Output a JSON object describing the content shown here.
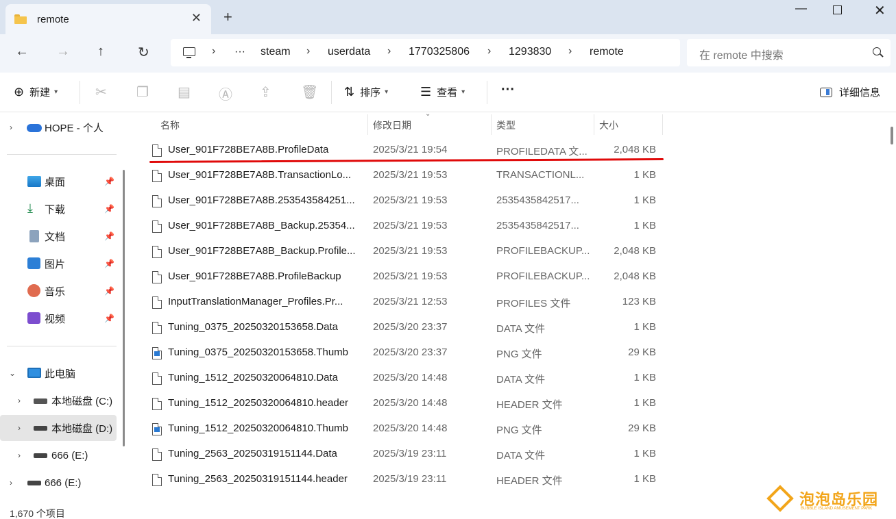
{
  "window": {
    "tab_title": "remote",
    "new_tab": "+",
    "close_tab": "✕"
  },
  "nav": {
    "breadcrumb": [
      "···",
      "steam",
      "userdata",
      "1770325806",
      "1293830",
      "remote"
    ],
    "search_placeholder": "在 remote 中搜索"
  },
  "toolbar": {
    "new_label": "新建",
    "sort_label": "排序",
    "view_label": "查看",
    "more_label": "···",
    "details_label": "详细信息"
  },
  "sidebar": {
    "onedrive": "HOPE - 个人",
    "quick": [
      {
        "label": "桌面",
        "icon": "desktop-icon"
      },
      {
        "label": "下载",
        "icon": "download-icon"
      },
      {
        "label": "文档",
        "icon": "documents-icon"
      },
      {
        "label": "图片",
        "icon": "pictures-icon"
      },
      {
        "label": "音乐",
        "icon": "music-icon"
      },
      {
        "label": "视频",
        "icon": "videos-icon"
      }
    ],
    "this_pc": "此电脑",
    "drives": [
      "本地磁盘 (C:)",
      "本地磁盘 (D:)",
      "666 (E:)"
    ],
    "external": "666 (E:)"
  },
  "columns": {
    "name": "名称",
    "date": "修改日期",
    "type": "类型",
    "size": "大小"
  },
  "files": [
    {
      "name": "User_901F728BE7A8B.ProfileData",
      "date": "2025/3/21 19:54",
      "type": "PROFILEDATA 文...",
      "size": "2,048 KB",
      "icon": "file"
    },
    {
      "name": "User_901F728BE7A8B.TransactionLo...",
      "date": "2025/3/21 19:53",
      "type": "TRANSACTIONL...",
      "size": "1 KB",
      "icon": "file"
    },
    {
      "name": "User_901F728BE7A8B.253543584251...",
      "date": "2025/3/21 19:53",
      "type": "2535435842517...",
      "size": "1 KB",
      "icon": "file"
    },
    {
      "name": "User_901F728BE7A8B_Backup.25354...",
      "date": "2025/3/21 19:53",
      "type": "2535435842517...",
      "size": "1 KB",
      "icon": "file"
    },
    {
      "name": "User_901F728BE7A8B_Backup.Profile...",
      "date": "2025/3/21 19:53",
      "type": "PROFILEBACKUP...",
      "size": "2,048 KB",
      "icon": "file"
    },
    {
      "name": "User_901F728BE7A8B.ProfileBackup",
      "date": "2025/3/21 19:53",
      "type": "PROFILEBACKUP...",
      "size": "2,048 KB",
      "icon": "file"
    },
    {
      "name": "InputTranslationManager_Profiles.Pr...",
      "date": "2025/3/21 12:53",
      "type": "PROFILES 文件",
      "size": "123 KB",
      "icon": "file"
    },
    {
      "name": "Tuning_0375_20250320153658.Data",
      "date": "2025/3/20 23:37",
      "type": "DATA 文件",
      "size": "1 KB",
      "icon": "file"
    },
    {
      "name": "Tuning_0375_20250320153658.Thumb",
      "date": "2025/3/20 23:37",
      "type": "PNG 文件",
      "size": "29 KB",
      "icon": "png"
    },
    {
      "name": "Tuning_1512_20250320064810.Data",
      "date": "2025/3/20 14:48",
      "type": "DATA 文件",
      "size": "1 KB",
      "icon": "file"
    },
    {
      "name": "Tuning_1512_20250320064810.header",
      "date": "2025/3/20 14:48",
      "type": "HEADER 文件",
      "size": "1 KB",
      "icon": "file"
    },
    {
      "name": "Tuning_1512_20250320064810.Thumb",
      "date": "2025/3/20 14:48",
      "type": "PNG 文件",
      "size": "29 KB",
      "icon": "png"
    },
    {
      "name": "Tuning_2563_20250319151144.Data",
      "date": "2025/3/19 23:11",
      "type": "DATA 文件",
      "size": "1 KB",
      "icon": "file"
    },
    {
      "name": "Tuning_2563_20250319151144.header",
      "date": "2025/3/19 23:11",
      "type": "HEADER 文件",
      "size": "1 KB",
      "icon": "file"
    }
  ],
  "status": {
    "item_count": "1,670 个项目"
  },
  "watermark": {
    "title": "泡泡岛乐园",
    "subtitle": "BUBBLE ISLAND AMUSEMENT PARK"
  },
  "colors": {
    "highlight": "#e00a0a",
    "titlebar": "#dbe4f0",
    "accent": "#2a73d9"
  }
}
